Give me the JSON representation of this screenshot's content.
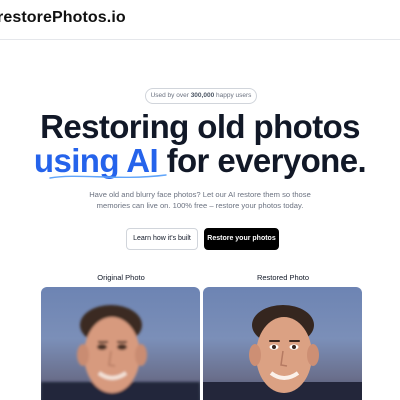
{
  "header": {
    "brand": "restorePhotos.io"
  },
  "hero": {
    "badge_prefix": "Used by over ",
    "badge_count": "300,000",
    "badge_suffix": " happy users",
    "title_line1": "Restoring old photos",
    "title_accent": "using AI",
    "title_rest": " for everyone.",
    "subtitle": "Have old and blurry face photos? Let our AI restore them so those memories can live on. 100% free – restore your photos today."
  },
  "actions": {
    "secondary_label": "Learn how it's built",
    "primary_label": "Restore your photos"
  },
  "comparison": {
    "original_label": "Original Photo",
    "restored_label": "Restored Photo"
  },
  "colors": {
    "accent": "#2563eb",
    "primary_button": "#000000",
    "text": "#111827",
    "muted": "#6b7280"
  }
}
